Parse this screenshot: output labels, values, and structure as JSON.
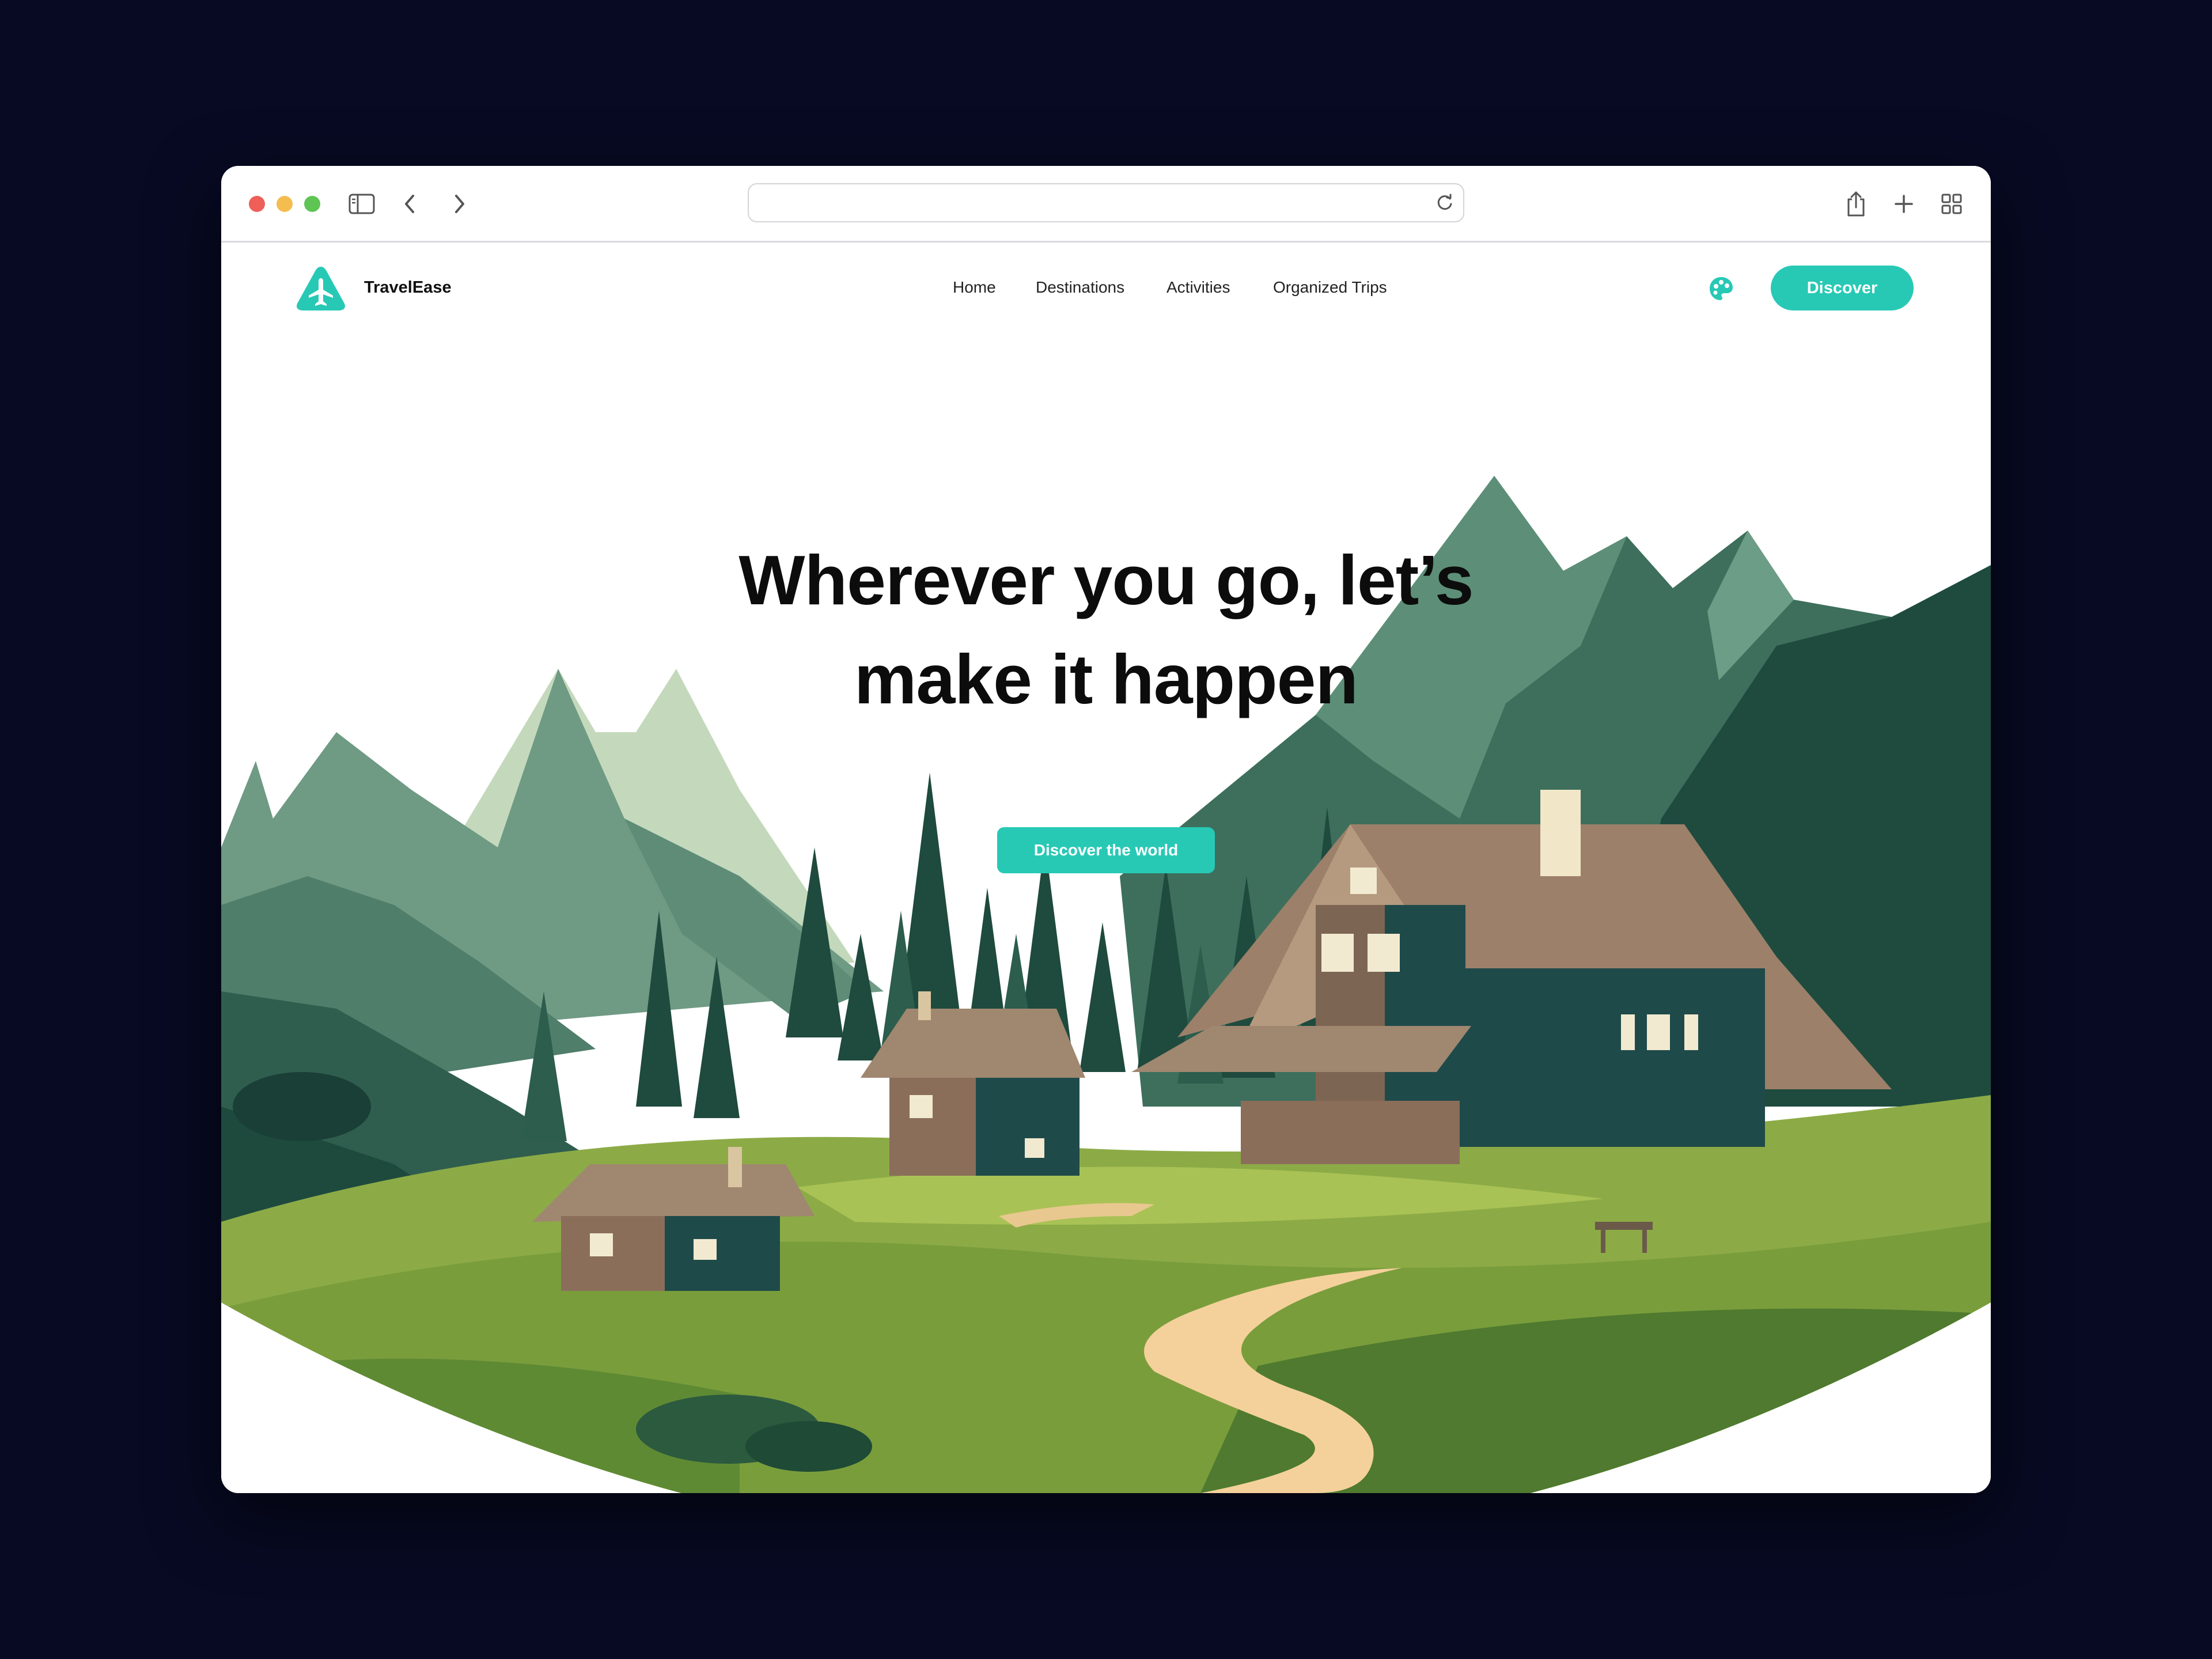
{
  "browser": {
    "address_value": "",
    "icons": [
      "sidebar-icon",
      "back-icon",
      "forward-icon",
      "reload-icon",
      "share-icon",
      "new-tab-icon",
      "tab-overview-icon"
    ]
  },
  "site": {
    "brand": "TravelEase",
    "logo_icon": "airplane-icon",
    "nav": {
      "home": "Home",
      "destinations": "Destinations",
      "activities": "Activities",
      "organized_trips": "Organized Trips"
    },
    "palette_icon": "palette-icon",
    "discover_button": "Discover"
  },
  "hero": {
    "headline_line1": "Wherever you go, let’s",
    "headline_line2": "make it happen",
    "cta": "Discover the world"
  },
  "colors": {
    "accent": "#27c9b5",
    "backdrop": "#070a22"
  }
}
